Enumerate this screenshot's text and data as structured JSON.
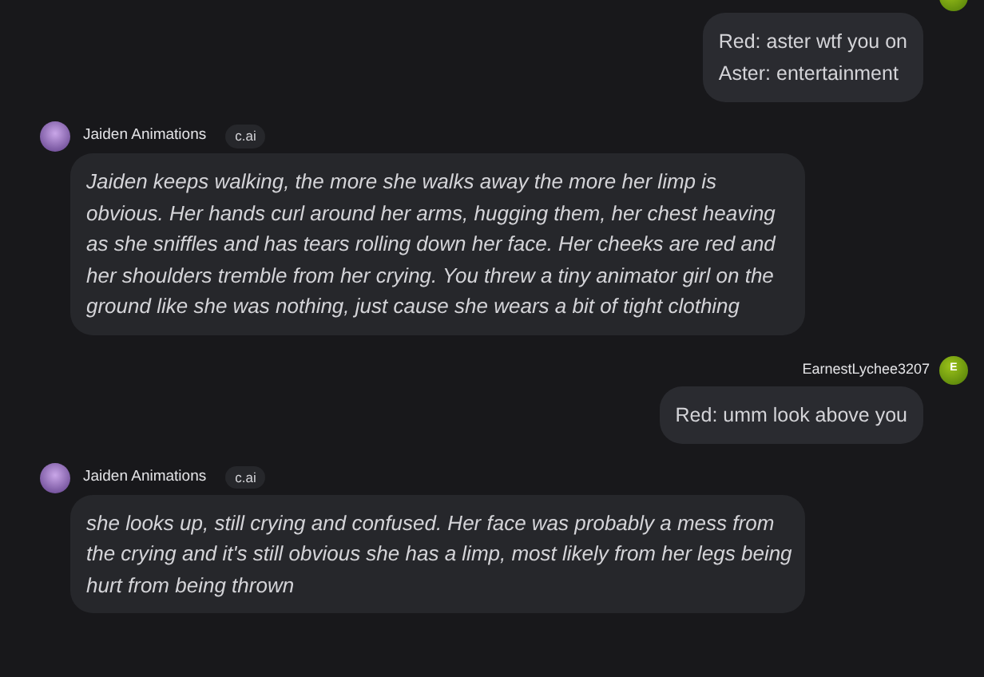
{
  "messages": [
    {
      "kind": "user",
      "lines": [
        "Red: aster wtf you on",
        "Aster: entertainment"
      ]
    },
    {
      "kind": "bot",
      "name": "Jaiden Animations",
      "badge": "c.ai",
      "text": "Jaiden keeps walking, the more she walks away the more her limp is obvious. Her hands curl around her arms, hugging them, her chest heaving as she sniffles and has tears rolling down her face. Her cheeks are red and her shoulders tremble from her crying. You threw a tiny animator girl on the ground like she was nothing, just cause she wears a bit of tight clothing"
    },
    {
      "kind": "user",
      "name": "EarnestLychee3207",
      "avatar_letter": "E",
      "lines": [
        "Red: umm look above you"
      ]
    },
    {
      "kind": "bot",
      "name": "Jaiden Animations",
      "badge": "c.ai",
      "text": "she looks up, still crying and confused. Her face was probably a mess from the crying and it's still obvious she has a limp, most likely from her legs being hurt from being thrown"
    }
  ]
}
